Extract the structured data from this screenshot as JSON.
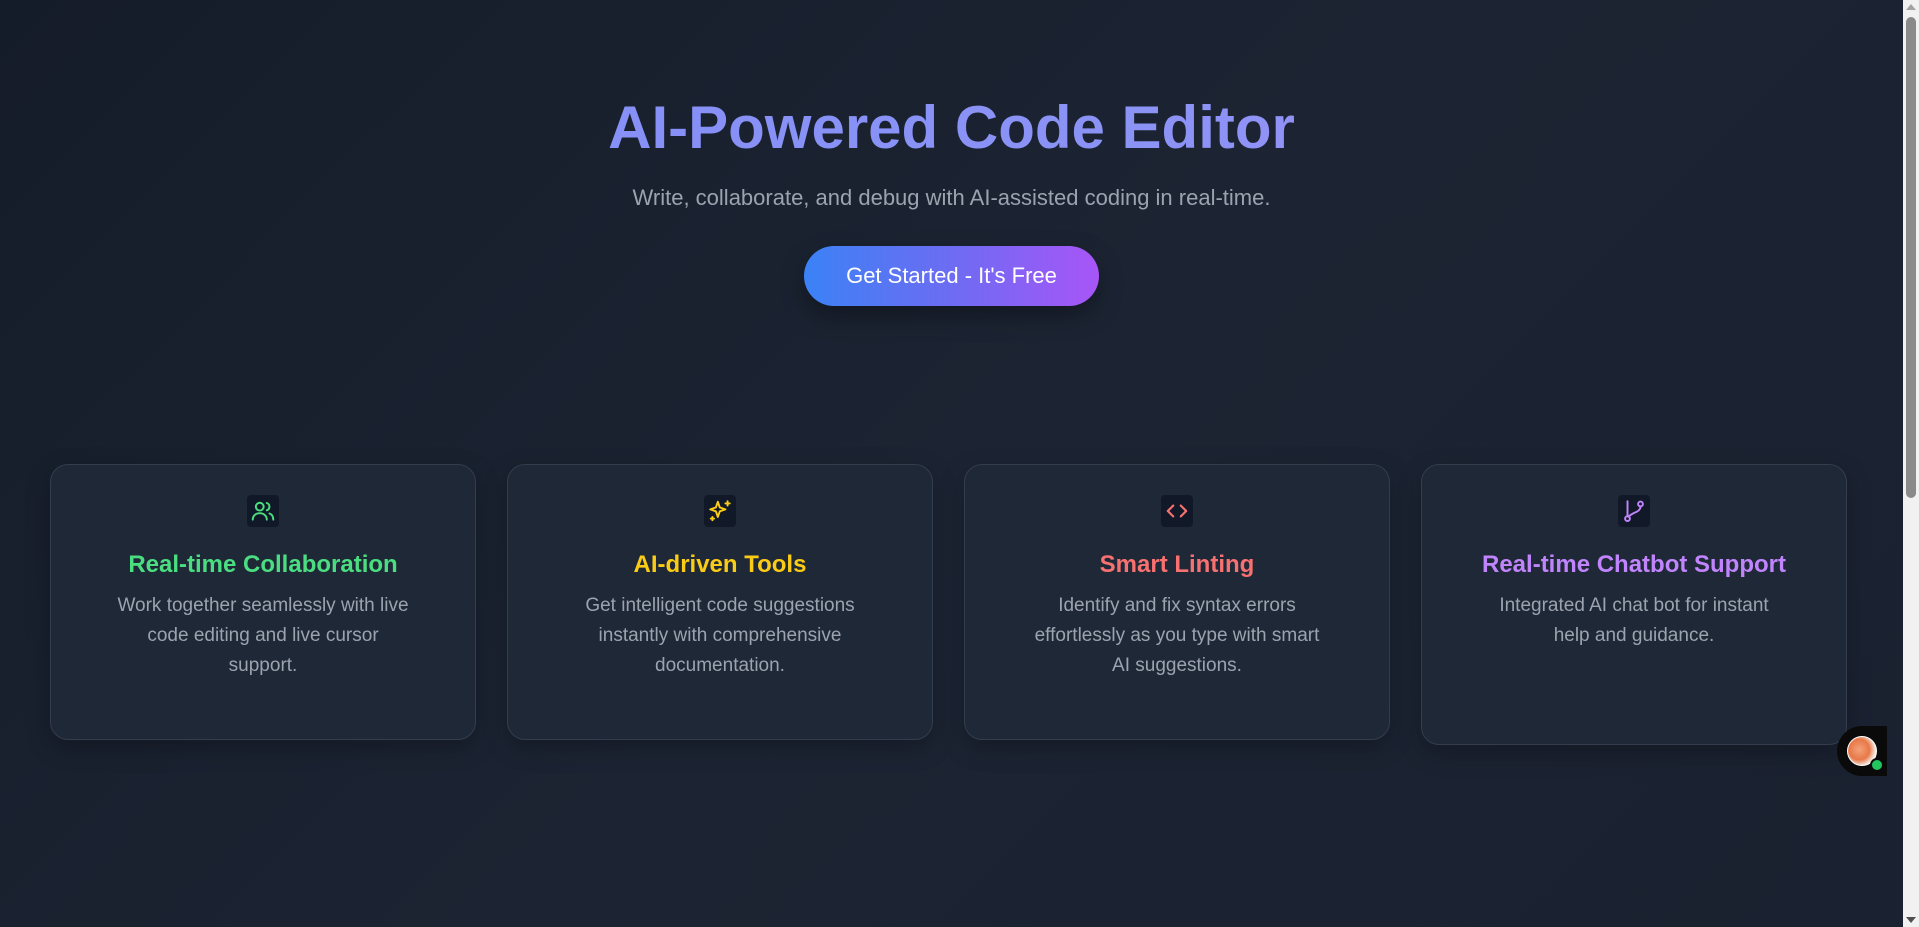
{
  "hero": {
    "title": "AI-Powered Code Editor",
    "subtitle": "Write, collaborate, and debug with AI-assisted coding in real-time.",
    "cta_label": "Get Started - It's Free"
  },
  "colors": {
    "collaboration": "#4ade80",
    "ai_tools": "#facc15",
    "linting": "#f87171",
    "chatbot": "#c084fc"
  },
  "features": [
    {
      "icon": "users-icon",
      "title": "Real-time Collaboration",
      "description": "Work together seamlessly with live code editing and live cursor support."
    },
    {
      "icon": "sparkles-icon",
      "title": "AI-driven Tools",
      "description": "Get intelligent code suggestions instantly with comprehensive documentation."
    },
    {
      "icon": "code-icon",
      "title": "Smart Linting",
      "description": "Identify and fix syntax errors effortlessly as you type with smart AI suggestions."
    },
    {
      "icon": "git-branch-icon",
      "title": "Real-time Chatbot Support",
      "description": "Integrated AI chat bot for instant help and guidance."
    }
  ]
}
